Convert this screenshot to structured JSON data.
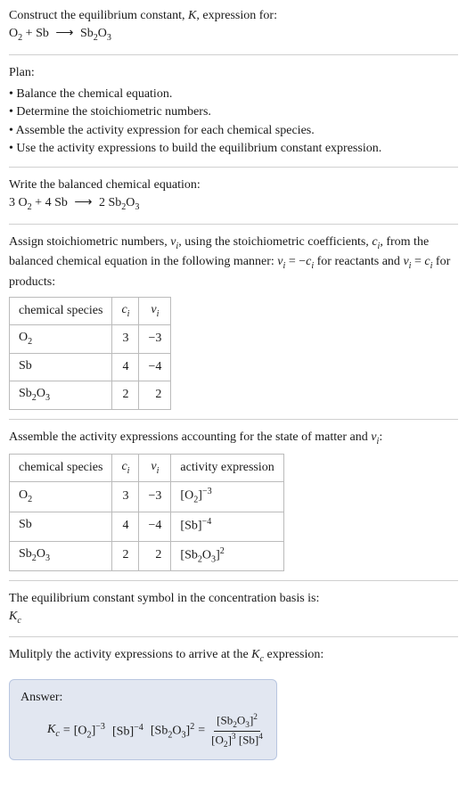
{
  "intro": {
    "line1": "Construct the equilibrium constant, ",
    "Ksym": "K",
    "line1b": ", expression for:",
    "eq_lhs_O2": "O",
    "eq_lhs_O2_sub": "2",
    "plus": " + ",
    "eq_lhs_Sb": "Sb",
    "arrow": "⟶",
    "eq_rhs_Sb2O3_a": "Sb",
    "eq_rhs_Sb2O3_b": "2",
    "eq_rhs_Sb2O3_c": "O",
    "eq_rhs_Sb2O3_d": "3"
  },
  "plan": {
    "heading": "Plan:",
    "b1": "Balance the chemical equation.",
    "b2": "Determine the stoichiometric numbers.",
    "b3": "Assemble the activity expression for each chemical species.",
    "b4": "Use the activity expressions to build the equilibrium constant expression."
  },
  "balanced": {
    "heading": "Write the balanced chemical equation:",
    "c1": "3 ",
    "O2a": "O",
    "O2b": "2",
    "plus": " + ",
    "c2": "4 ",
    "Sb": "Sb",
    "arrow": "⟶",
    "c3": " 2 ",
    "Sb2O3a": "Sb",
    "Sb2O3b": "2",
    "Sb2O3c": "O",
    "Sb2O3d": "3"
  },
  "stoich": {
    "text_a": "Assign stoichiometric numbers, ",
    "nu": "ν",
    "sub_i": "i",
    "text_b": ", using the stoichiometric coefficients, ",
    "csym": "c",
    "text_c": ", from the balanced chemical equation in the following manner: ",
    "rel1a": "ν",
    "rel1b": "i",
    "rel1c": " = −",
    "rel1d": "c",
    "rel1e": "i",
    "text_d": " for reactants and ",
    "rel2a": "ν",
    "rel2b": "i",
    "rel2c": " = ",
    "rel2d": "c",
    "rel2e": "i",
    "text_e": " for products:",
    "hdr_species": "chemical species",
    "hdr_ci_sym": "c",
    "hdr_ci_sub": "i",
    "hdr_nu_sym": "ν",
    "hdr_nu_sub": "i",
    "rows": [
      {
        "sp_a": "O",
        "sp_b": "2",
        "sp_c": "",
        "sp_d": "",
        "ci": "3",
        "nu": "−3"
      },
      {
        "sp_a": "Sb",
        "sp_b": "",
        "sp_c": "",
        "sp_d": "",
        "ci": "4",
        "nu": "−4"
      },
      {
        "sp_a": "Sb",
        "sp_b": "2",
        "sp_c": "O",
        "sp_d": "3",
        "ci": "2",
        "nu": "2"
      }
    ]
  },
  "activity": {
    "text_a": "Assemble the activity expressions accounting for the state of matter and ",
    "nu": "ν",
    "sub_i": "i",
    "colon": ":",
    "hdr_species": "chemical species",
    "hdr_ci_sym": "c",
    "hdr_ci_sub": "i",
    "hdr_nu_sym": "ν",
    "hdr_nu_sub": "i",
    "hdr_activity": "activity expression",
    "rows": [
      {
        "sp_a": "O",
        "sp_b": "2",
        "sp_c": "",
        "sp_d": "",
        "ci": "3",
        "nu": "−3",
        "ae_open": "[",
        "ae_a": "O",
        "ae_b": "2",
        "ae_c": "",
        "ae_d": "",
        "ae_close": "]",
        "ae_exp": "−3"
      },
      {
        "sp_a": "Sb",
        "sp_b": "",
        "sp_c": "",
        "sp_d": "",
        "ci": "4",
        "nu": "−4",
        "ae_open": "[",
        "ae_a": "Sb",
        "ae_b": "",
        "ae_c": "",
        "ae_d": "",
        "ae_close": "]",
        "ae_exp": "−4"
      },
      {
        "sp_a": "Sb",
        "sp_b": "2",
        "sp_c": "O",
        "sp_d": "3",
        "ci": "2",
        "nu": "2",
        "ae_open": "[",
        "ae_a": "Sb",
        "ae_b": "2",
        "ae_c": "O",
        "ae_d": "3",
        "ae_close": "]",
        "ae_exp": "2"
      }
    ]
  },
  "ksymbol": {
    "text": "The equilibrium constant symbol in the concentration basis is:",
    "K": "K",
    "sub": "c"
  },
  "multiply": {
    "text_a": "Mulitply the activity expressions to arrive at the ",
    "K": "K",
    "sub": "c",
    "text_b": " expression:"
  },
  "answer": {
    "label": "Answer:",
    "K": "K",
    "Ksub": "c",
    "eq": " = ",
    "t1o": "[",
    "t1a": "O",
    "t1b": "2",
    "t1c": "]",
    "t1e": "−3",
    "sp1": " ",
    "t2o": "[",
    "t2a": "Sb",
    "t2c": "]",
    "t2e": "−4",
    "sp2": " ",
    "t3o": "[",
    "t3a": "Sb",
    "t3b": "2",
    "t3c2": "O",
    "t3d": "3",
    "t3c": "]",
    "t3e": "2",
    "eq2": " = ",
    "num_o": "[",
    "num_a": "Sb",
    "num_b": "2",
    "num_c2": "O",
    "num_d": "3",
    "num_c": "]",
    "num_e": "2",
    "den1_o": "[",
    "den1_a": "O",
    "den1_b": "2",
    "den1_c": "]",
    "den1_e": "3",
    "den_sp": " ",
    "den2_o": "[",
    "den2_a": "Sb",
    "den2_c": "]",
    "den2_e": "4"
  }
}
